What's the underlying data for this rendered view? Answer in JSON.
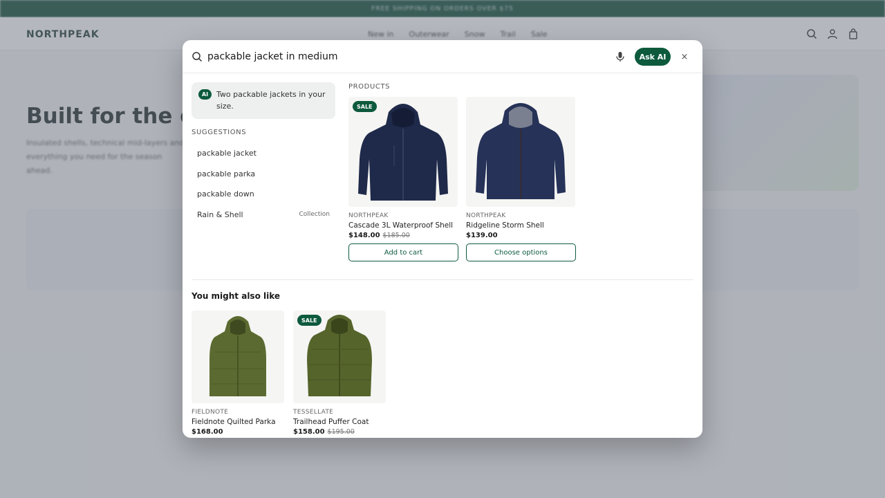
{
  "announcement": "FREE SHIPPING ON ORDERS OVER $75",
  "header": {
    "logo": "NORTHPEAK",
    "nav": [
      "New in",
      "Outerwear",
      "Snow",
      "Trail",
      "Sale"
    ]
  },
  "hero": {
    "title": "Built for the cold",
    "subtitle": "Insulated shells, technical mid-layers and everything you need for the season ahead."
  },
  "search": {
    "query": "packable jacket in medium",
    "ask_ai_label": "Ask AI",
    "close_label": "×"
  },
  "ai_answer": {
    "badge": "AI",
    "text": "Two packable jackets in your size."
  },
  "suggestions": {
    "heading": "SUGGESTIONS",
    "items": [
      {
        "label": "packable jacket",
        "tag": ""
      },
      {
        "label": "packable parka",
        "tag": ""
      },
      {
        "label": "packable down",
        "tag": ""
      },
      {
        "label": "Rain & Shell",
        "tag": "Collection"
      }
    ]
  },
  "products": {
    "heading": "PRODUCTS",
    "items": [
      {
        "badge": "SALE",
        "brand": "NORTHPEAK",
        "name": "Cascade 3L Waterproof Shell",
        "price": "$148.00",
        "old_price": "$185.00",
        "cta": "Add to cart"
      },
      {
        "badge": "",
        "brand": "NORTHPEAK",
        "name": "Ridgeline Storm Shell",
        "price": "$139.00",
        "old_price": "",
        "cta": "Choose options"
      }
    ]
  },
  "also_like": {
    "heading": "You might also like",
    "items": [
      {
        "badge": "",
        "brand": "FIELDNOTE",
        "name": "Fieldnote Quilted Parka",
        "price": "$168.00",
        "old_price": ""
      },
      {
        "badge": "SALE",
        "brand": "TESSELLATE",
        "name": "Trailhead Puffer Coat",
        "price": "$158.00",
        "old_price": "$195.00"
      }
    ]
  },
  "colors": {
    "brand_green": "#0d5a3d",
    "navy_jacket": "#1f2a4a",
    "olive_jacket": "#5b6a30"
  }
}
